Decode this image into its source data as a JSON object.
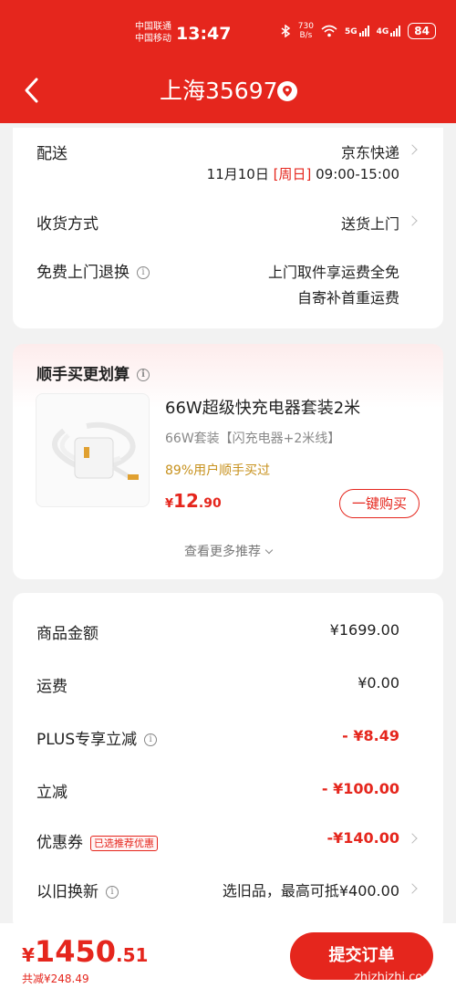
{
  "colors": {
    "brand": "#e5261d",
    "accent_gold": "#c7911d"
  },
  "statusbar": {
    "carrier1": "中国联通",
    "carrier2": "中国移动",
    "time": "13:47",
    "speed_value": "730",
    "speed_unit": "B/s",
    "signal1_label": "5G",
    "signal2_label": "4G",
    "battery": "84"
  },
  "header": {
    "title": "上海35697",
    "back_icon": "back-arrow-icon",
    "location_icon": "location-pin-icon"
  },
  "delivery": {
    "label": "配送",
    "carrier": "京东快递",
    "date": "11月10日",
    "weekday": "[周日]",
    "time_window": "09:00-15:00"
  },
  "receipt": {
    "label": "收货方式",
    "value": "送货上门"
  },
  "return": {
    "label": "免费上门退换",
    "line1": "上门取件享运费全免",
    "line2": "自寄补首重运费"
  },
  "addon": {
    "title": "顺手买更划算",
    "product_name": "66W超级快充电器套装2米",
    "spec": "66W套装【闪充电器+2米线】",
    "popularity": "89%用户顺手买过",
    "price_symbol": "¥",
    "price_int": "12",
    "price_dec": ".90",
    "buy_button": "一键购买",
    "more": "查看更多推荐"
  },
  "summary": {
    "goods_label": "商品金额",
    "goods_value": "¥1699.00",
    "shipping_label": "运费",
    "shipping_value": "¥0.00",
    "plus_label": "PLUS专享立减",
    "plus_value": "- ¥8.49",
    "discount_label": "立减",
    "discount_value": "- ¥100.00",
    "coupon_label": "优惠券",
    "coupon_tag": "已选推荐优惠",
    "coupon_value": "-¥140.00",
    "tradein_label": "以旧换新",
    "tradein_value": "选旧品，最高可抵¥400.00"
  },
  "footer": {
    "price_symbol": "¥",
    "price_int": "1450",
    "price_dec": ".51",
    "saved": "共减¥248.49",
    "submit": "提交订单",
    "watermark": "zhizhizhi.com"
  }
}
